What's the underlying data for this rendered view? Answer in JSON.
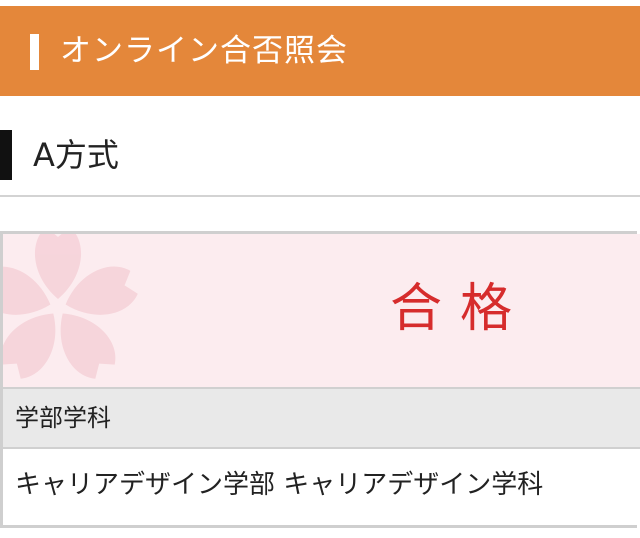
{
  "header": {
    "title": "オンライン合否照会"
  },
  "section": {
    "heading": "A方式"
  },
  "result": {
    "status": "合格",
    "decoration": "sakura-icon",
    "color": "#d62c2c",
    "background": "#fcecef"
  },
  "details": {
    "label": "学部学科",
    "value": "キャリアデザイン学部 キャリアデザイン学科"
  },
  "colors": {
    "header": "#e4873a"
  }
}
